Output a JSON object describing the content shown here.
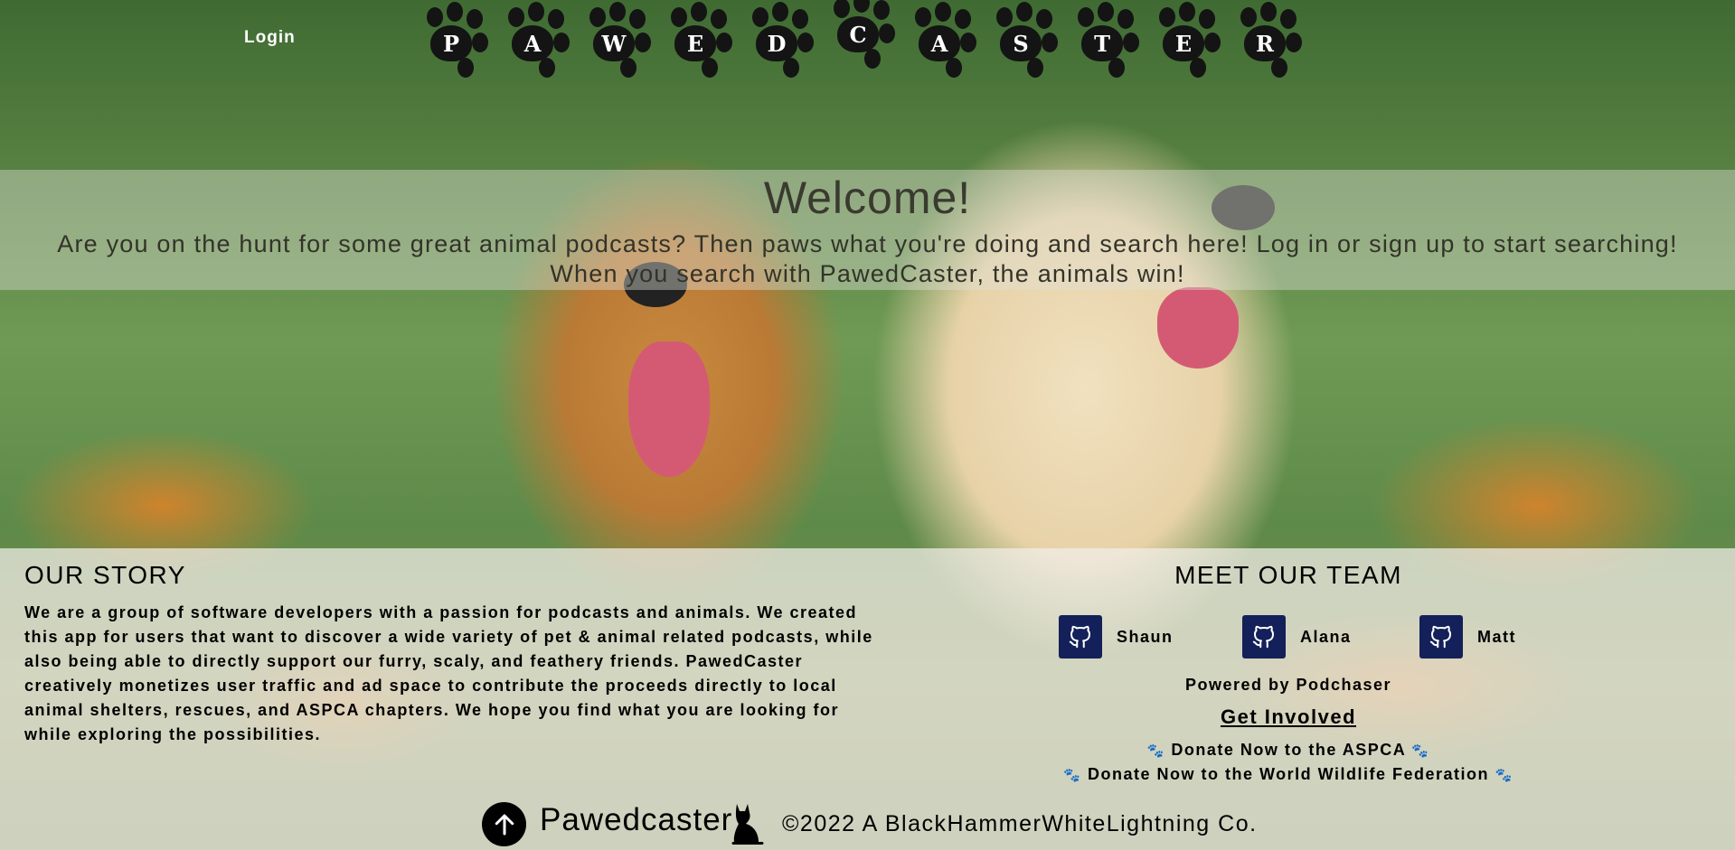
{
  "header": {
    "login_label": "Login",
    "logo_letters": [
      "P",
      "A",
      "W",
      "E",
      "D",
      "C",
      "A",
      "S",
      "T",
      "E",
      "R"
    ]
  },
  "welcome": {
    "title": "Welcome!",
    "text": "Are you on the hunt for some great animal podcasts? Then paws what you're doing and search here! Log in or sign up to start searching! When you search with PawedCaster, the animals win!"
  },
  "story": {
    "title": "OUR STORY",
    "text": "We are a group of software developers with a passion for podcasts and animals. We created this app for users that want to discover a wide variety of pet & animal related podcasts, while also being able to directly support our furry, scaly, and feathery friends. PawedCaster creatively monetizes user traffic and ad space to contribute the proceeds directly to local animal shelters, rescues, and ASPCA chapters. We hope you find what you are looking for while exploring the possibilities."
  },
  "team": {
    "title": "MEET OUR TEAM",
    "members": [
      "Shaun",
      "Alana",
      "Matt"
    ],
    "github_icon_color": "#14205a"
  },
  "links": {
    "powered_by": "Powered by Podchaser",
    "get_involved": "Get Involved",
    "donate_aspca": "Donate Now to the ASPCA",
    "donate_wwf": "Donate Now to the World Wildlife Federation"
  },
  "footer": {
    "brand": "Pawedcaster",
    "copyright": "©2022 A BlackHammerWhiteLightning Co."
  }
}
